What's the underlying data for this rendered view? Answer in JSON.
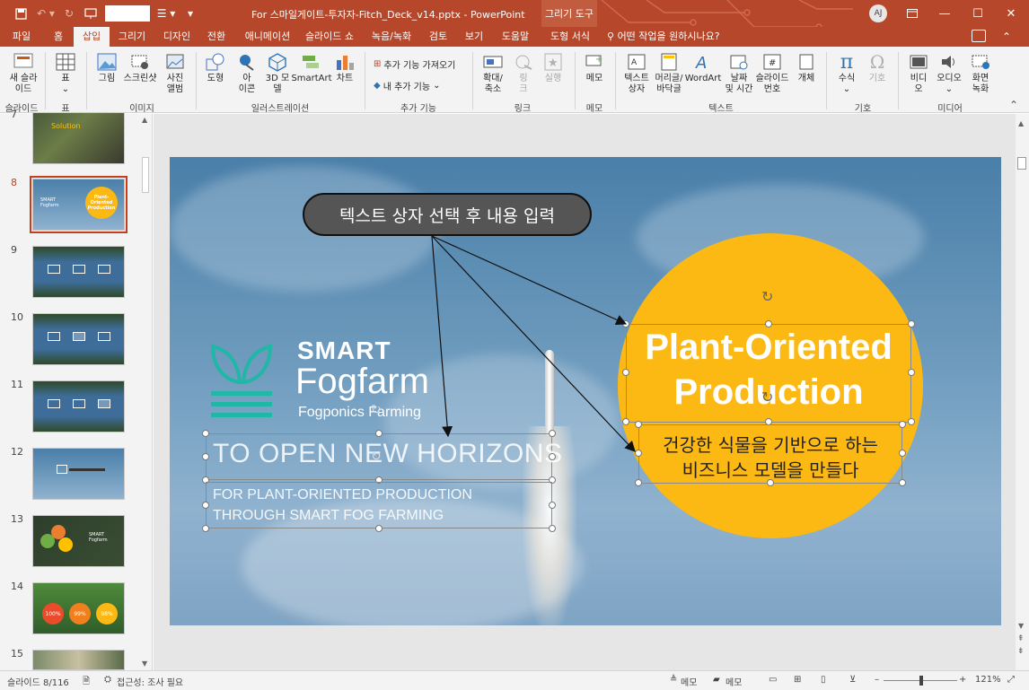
{
  "titlebar": {
    "file_title": "For 스마일게이트-투자자-Fitch_Deck_v14.pptx  -  PowerPoint",
    "drawing_tools": "그리기 도구",
    "avatar_initials": "AJ"
  },
  "tabs": [
    {
      "label": "파일"
    },
    {
      "label": "홈"
    },
    {
      "label": "삽입"
    },
    {
      "label": "그리기"
    },
    {
      "label": "디자인"
    },
    {
      "label": "전환"
    },
    {
      "label": "애니메이션"
    },
    {
      "label": "슬라이드 쇼"
    },
    {
      "label": "녹음/녹화"
    },
    {
      "label": "검토"
    },
    {
      "label": "보기"
    },
    {
      "label": "도움말"
    },
    {
      "label": "도형 서식"
    }
  ],
  "tell_me": "어떤 작업을 원하시나요?",
  "ribbon": {
    "new_slide_1": "새 슬라",
    "new_slide_2": "이드",
    "table": "표",
    "picture": "그림",
    "screenshot": "스크린샷",
    "photo_album_1": "사진",
    "photo_album_2": "앨범",
    "shapes": "도형",
    "icons_1": "아",
    "icons_2": "이콘",
    "model3d_1": "3D 모",
    "model3d_2": "델",
    "smartart": "SmartArt",
    "chart": "차트",
    "get_addins": "추가 기능 가져오기",
    "my_addins": "내 추가 기능",
    "zoom_1": "확대/",
    "zoom_2": "축소",
    "link_1": "링",
    "link_2": "크",
    "action": "실행",
    "comment": "메모",
    "textbox_1": "텍스트",
    "textbox_2": "상자",
    "header_1": "머리글/",
    "header_2": "바닥글",
    "wordart": "WordArt",
    "datetime_1": "날짜",
    "datetime_2": "및 시간",
    "slidenum_1": "슬라이드",
    "slidenum_2": "번호",
    "object": "개체",
    "equation": "수식",
    "symbol": "기호",
    "video_1": "비디",
    "video_2": "오",
    "audio": "오디오",
    "screenrec_1": "화면",
    "screenrec_2": "녹화",
    "groups": {
      "slides": "슬라이드",
      "tables": "표",
      "images": "이미지",
      "illustrations": "일러스트레이션",
      "addins": "추가 기능",
      "links": "링크",
      "comments": "메모",
      "text": "텍스트",
      "symbols": "기호",
      "media": "미디어"
    }
  },
  "thumbnails": [
    {
      "num": "7"
    },
    {
      "num": "8"
    },
    {
      "num": "9"
    },
    {
      "num": "10"
    },
    {
      "num": "11"
    },
    {
      "num": "12"
    },
    {
      "num": "13"
    },
    {
      "num": "14"
    },
    {
      "num": "15"
    }
  ],
  "thumb_texts": {
    "solution": "Solution",
    "plant_oriented": "Plant-Oriented Production",
    "smart_fogfarm": "SMART Fogfarm",
    "p100": "100%",
    "p99": "99%",
    "p98": "98%"
  },
  "slide": {
    "logo_smart": "SMART",
    "logo_fogfarm": "Fogfarm",
    "logo_tagline": "Fogponics Farming",
    "headline": "TO OPEN NEW HORIZONS",
    "subline_1": "FOR PLANT-ORIENTED PRODUCTION",
    "subline_2": "THROUGH  SMART FOG FARMING",
    "circle_title_1": "Plant-Oriented",
    "circle_title_2": "Production",
    "circle_sub_1": "건강한 식물을 기반으로 하는",
    "circle_sub_2": "비즈니스 모델을 만들다",
    "callout": "텍스트 상자 선택 후 내용 입력"
  },
  "status": {
    "slide_counter": "슬라이드 8/116",
    "accessibility": "접근성: 조사 필요",
    "notes": "메모",
    "comments": "메모",
    "zoom": "121%"
  },
  "colors": {
    "accent": "#b7472a",
    "circle": "#fdb913",
    "logo_teal": "#1fb7a6"
  }
}
